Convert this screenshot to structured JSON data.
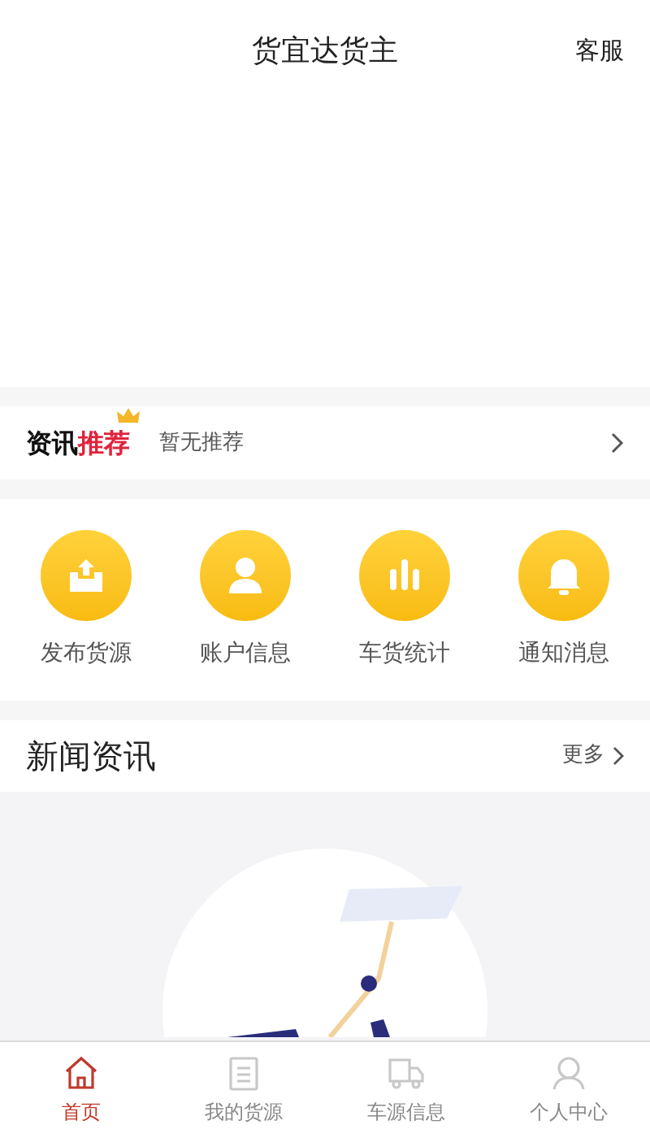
{
  "header": {
    "title": "货宜达货主",
    "service": "客服"
  },
  "recommend": {
    "title_plain": "资讯",
    "title_accent": "推荐",
    "text": "暂无推荐"
  },
  "shortcuts": [
    {
      "kind": "publish",
      "label": "发布货源"
    },
    {
      "kind": "account",
      "label": "账户信息"
    },
    {
      "kind": "stats",
      "label": "车货统计"
    },
    {
      "kind": "notice",
      "label": "通知消息"
    }
  ],
  "news": {
    "title": "新闻资讯",
    "more": "更多"
  },
  "tabbar": [
    {
      "kind": "home",
      "label": "首页",
      "selected": true
    },
    {
      "kind": "list",
      "label": "我的货源",
      "selected": false
    },
    {
      "kind": "truck",
      "label": "车源信息",
      "selected": false
    },
    {
      "kind": "user",
      "label": "个人中心",
      "selected": false
    }
  ]
}
